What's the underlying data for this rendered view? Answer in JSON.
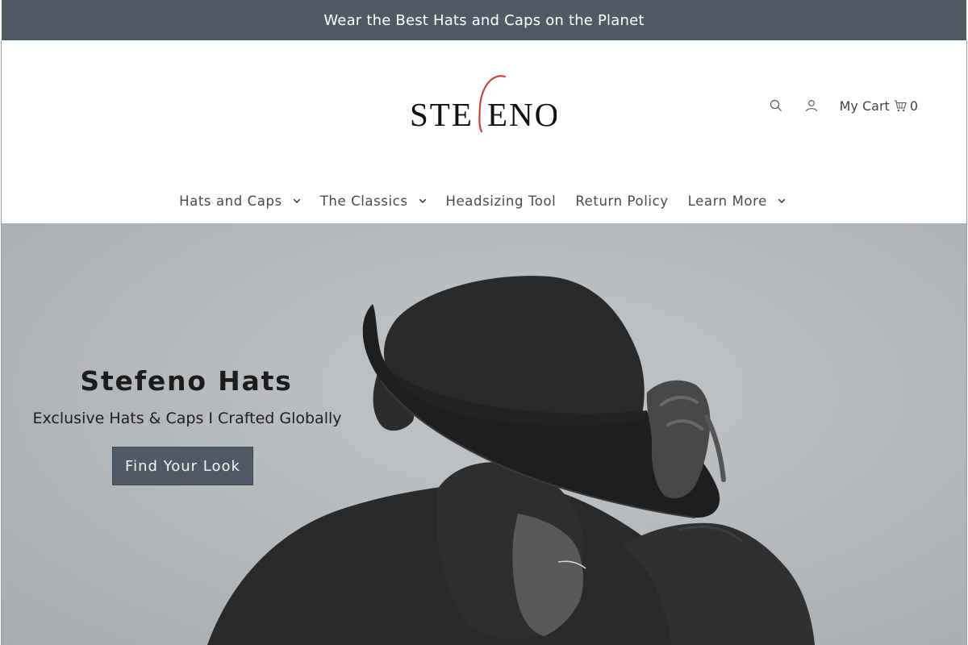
{
  "announcement": {
    "text": "Wear the Best Hats and Caps on the Planet"
  },
  "brand": {
    "logo_text": "STEFENO",
    "accent_color": "#c0473a",
    "primary_color": "#4f5a66"
  },
  "header": {
    "search_icon": "search-icon",
    "account_icon": "user-icon",
    "cart": {
      "label": "My Cart",
      "icon": "cart-icon",
      "count": "0"
    }
  },
  "nav": {
    "items": [
      {
        "label": "Hats and Caps",
        "has_dropdown": true
      },
      {
        "label": "The Classics",
        "has_dropdown": true
      },
      {
        "label": "Headsizing Tool",
        "has_dropdown": false
      },
      {
        "label": "Return Policy",
        "has_dropdown": false
      },
      {
        "label": "Learn More",
        "has_dropdown": true
      }
    ]
  },
  "hero": {
    "title": "Stefeno Hats",
    "subtitle": "Exclusive Hats & Caps I Crafted Globally",
    "button_label": "Find Your Look"
  }
}
